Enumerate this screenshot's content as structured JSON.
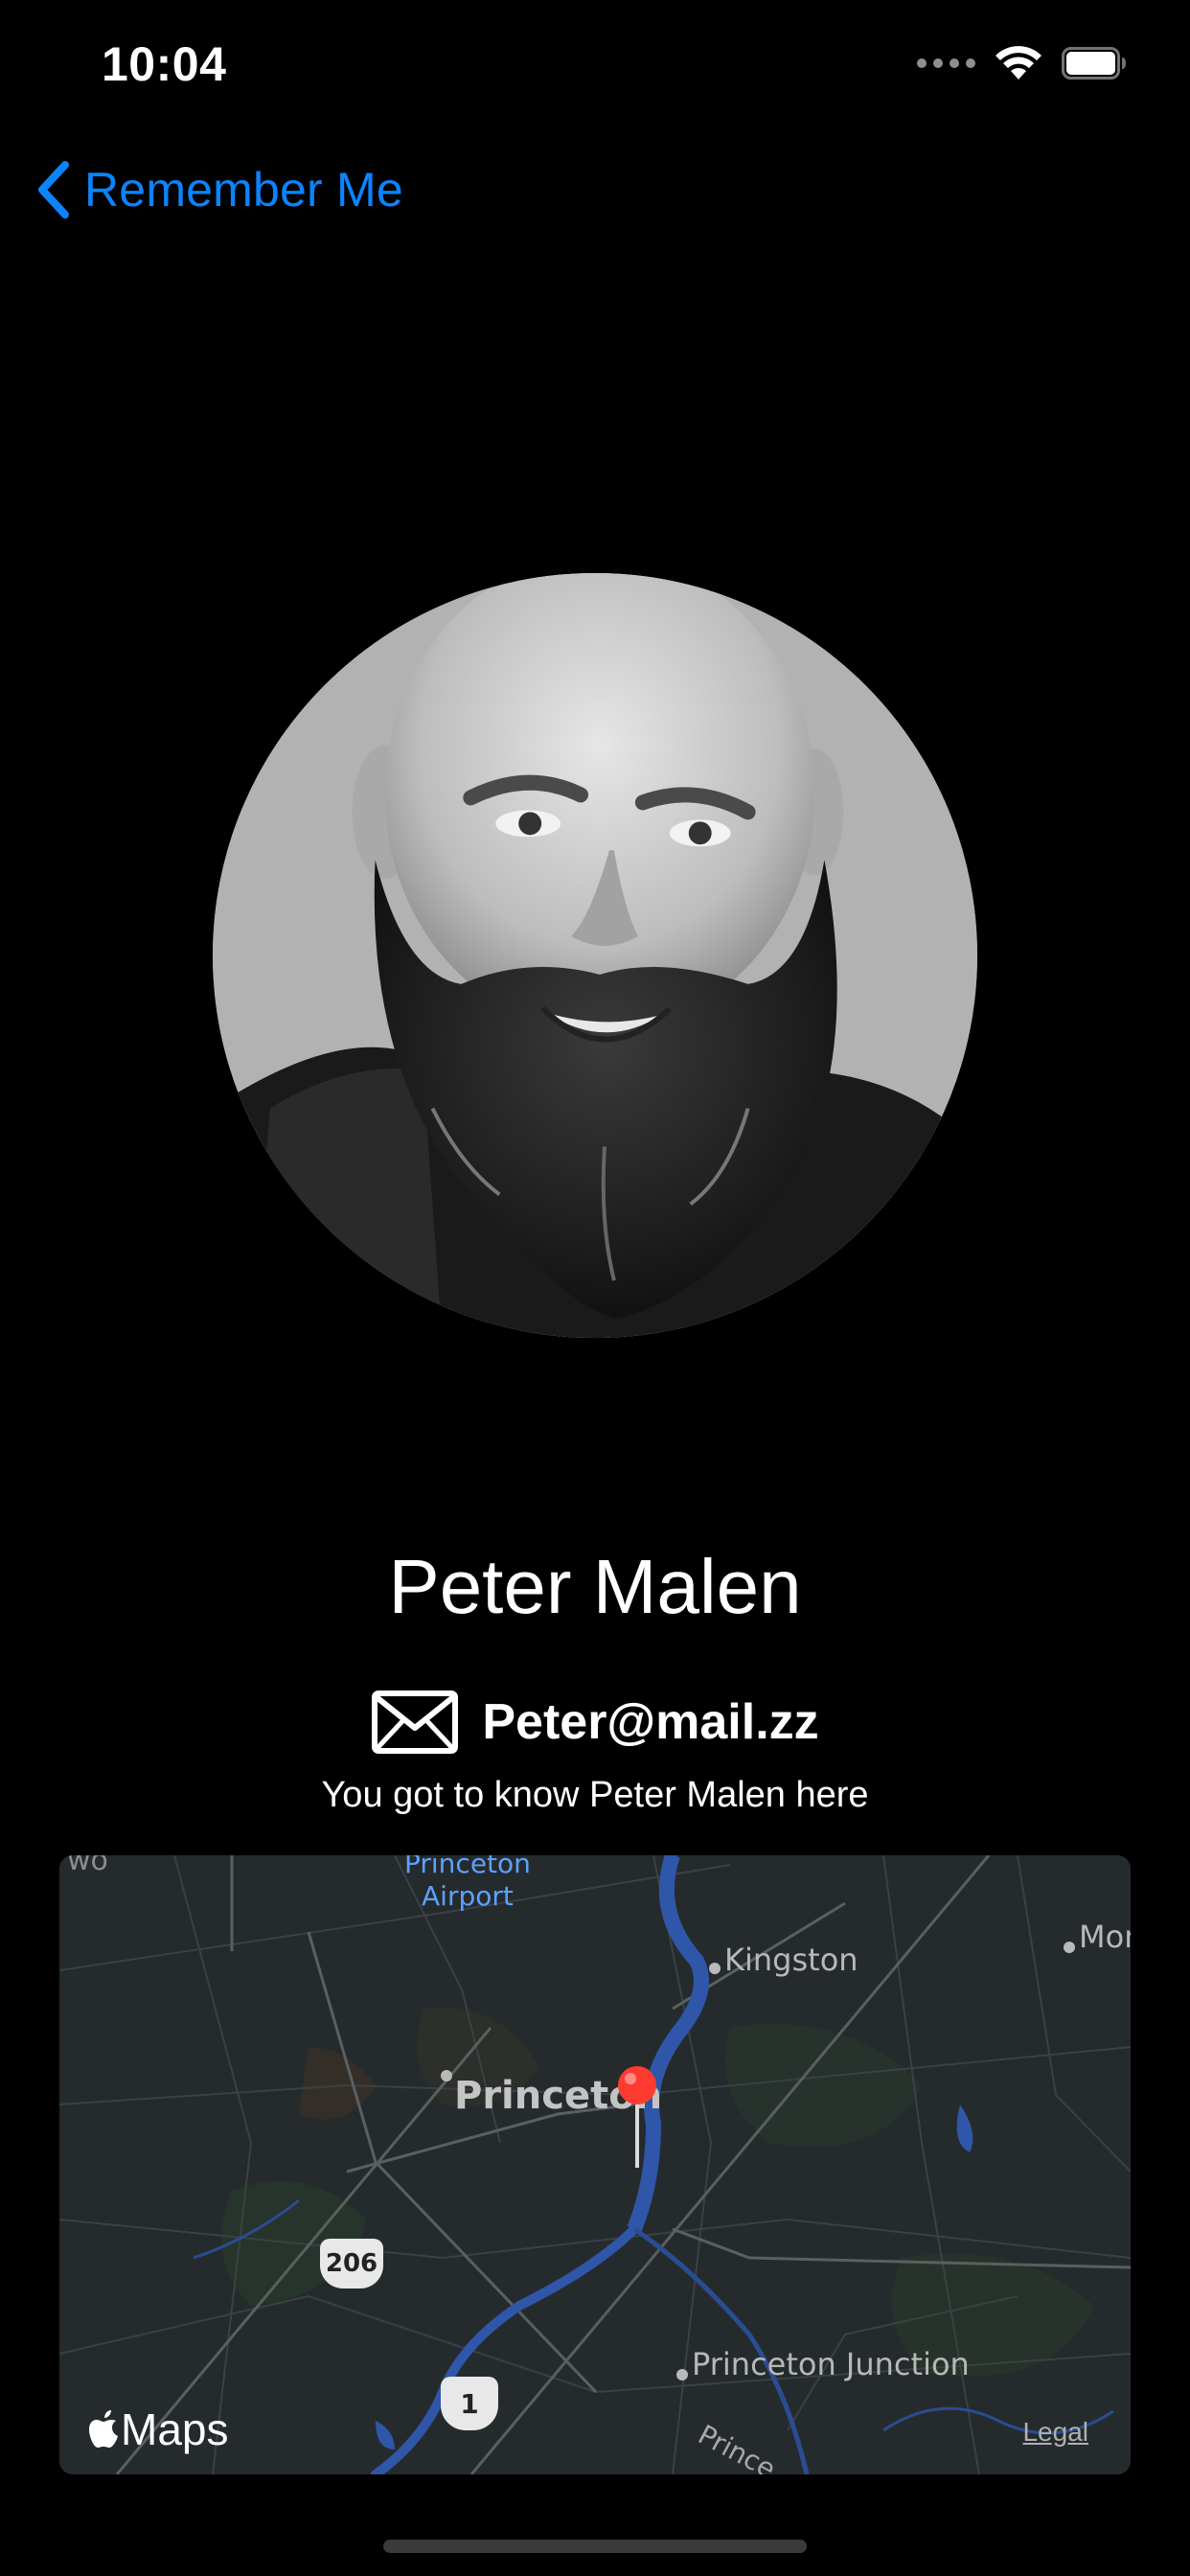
{
  "status_bar": {
    "time": "10:04"
  },
  "nav": {
    "back_label": "Remember Me"
  },
  "person": {
    "name": "Peter Malen",
    "email": "Peter@mail.zz",
    "known_text": "You got to know Peter Malen here"
  },
  "map": {
    "labels": {
      "airport": "Princeton\nAirport",
      "kingston": "Kingston",
      "princeton": "Princeton",
      "princeton_junction": "Princeton Junction",
      "mon": "Mon",
      "edge_top_left": "wo",
      "edge_bottom": "Prince"
    },
    "shields": {
      "route_206": "206",
      "route_1": "1"
    },
    "attribution": "Maps",
    "legal": "Legal"
  },
  "colors": {
    "accent": "#0a84ff",
    "background": "#000000",
    "pin": "#ff3b30",
    "map_water": "#2f56a8"
  },
  "icons": {
    "back": "chevron-left-icon",
    "mail": "envelope-icon",
    "wifi": "wifi-icon",
    "battery": "battery-icon",
    "pin": "map-pin-icon",
    "apple": "apple-logo-icon"
  }
}
